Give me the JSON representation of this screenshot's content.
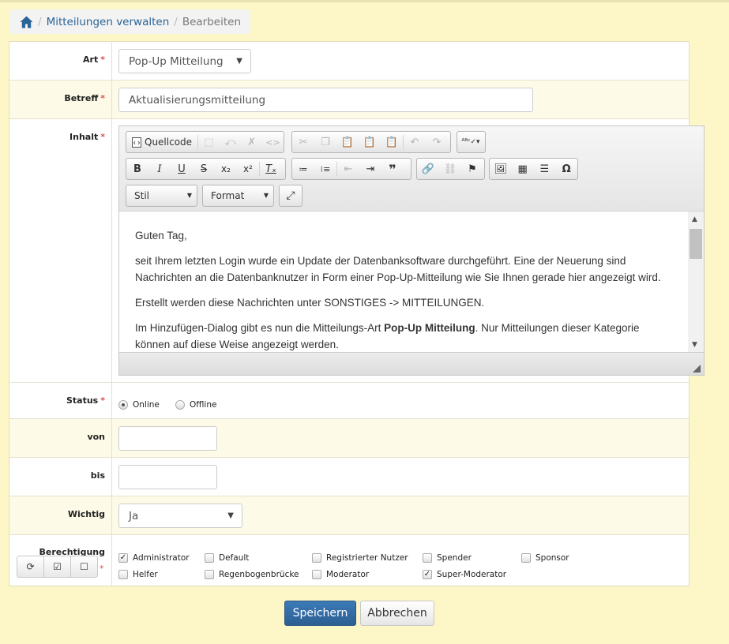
{
  "breadcrumb": {
    "home_icon": "home-icon",
    "items": [
      "Mitteilungen verwalten",
      "Bearbeiten"
    ]
  },
  "fields": {
    "art": {
      "label": "Art",
      "value": "Pop-Up Mitteilung"
    },
    "betreff": {
      "label": "Betreff",
      "value": "Aktualisierungsmitteilung"
    },
    "inhalt": {
      "label": "Inhalt"
    },
    "status": {
      "label": "Status",
      "options": [
        "Online",
        "Offline"
      ],
      "selected": "Online"
    },
    "von": {
      "label": "von",
      "value": ""
    },
    "bis": {
      "label": "bis",
      "value": ""
    },
    "wichtig": {
      "label": "Wichtig",
      "value": "Ja"
    },
    "berechtigung": {
      "label": "Berechtigung"
    }
  },
  "editor": {
    "source_label": "Quellcode",
    "style_combo": "Stil",
    "format_combo": "Format",
    "content": {
      "p1": "Guten Tag,",
      "p2": "seit Ihrem letzten Login wurde ein Update der Datenbanksoftware durchgeführt. Eine der Neuerung sind Nachrichten an die Datenbanknutzer in Form einer Pop-Up-Mitteilung wie Sie Ihnen gerade hier angezeigt wird.",
      "p3": "Erstellt werden diese Nachrichten unter SONSTIGES -> MITTEILUNGEN.",
      "p4a": "Im Hinzufügen-Dialog gibt es nun die Mitteilungs-Art ",
      "p4b": "Pop-Up Mitteilung",
      "p4c": ". Nur Mitteilungen dieser Kategorie können auf diese Weise angezeigt werden."
    }
  },
  "permissions": [
    {
      "label": "Administrator",
      "checked": true
    },
    {
      "label": "Default",
      "checked": false
    },
    {
      "label": "Registrierter Nutzer",
      "checked": false
    },
    {
      "label": "Spender",
      "checked": false
    },
    {
      "label": "Sponsor",
      "checked": false
    },
    {
      "label": "Helfer",
      "checked": false
    },
    {
      "label": "Regenbogenbrücke",
      "checked": false
    },
    {
      "label": "Moderator",
      "checked": false
    },
    {
      "label": "Super-Moderator",
      "checked": true
    }
  ],
  "actions": {
    "save": "Speichern",
    "cancel": "Abbrechen"
  },
  "colors": {
    "primary": "#2f6da8",
    "required": "#d9534f",
    "page_bg": "#fdf7c8"
  }
}
